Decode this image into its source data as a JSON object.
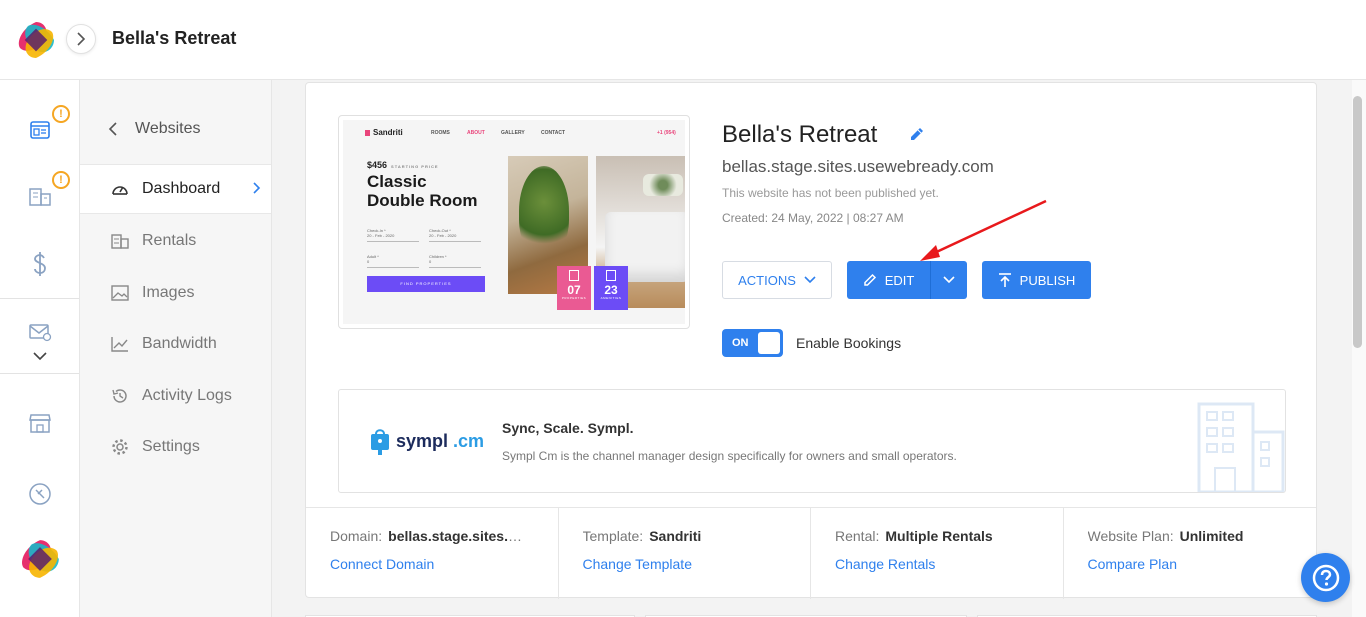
{
  "header": {
    "title": "Bella's Retreat"
  },
  "subnav": {
    "back_label": "Websites",
    "items": [
      {
        "label": "Dashboard",
        "icon": "gauge-icon",
        "active": true
      },
      {
        "label": "Rentals",
        "icon": "building-icon",
        "active": false
      },
      {
        "label": "Images",
        "icon": "image-icon",
        "active": false
      },
      {
        "label": "Bandwidth",
        "icon": "trend-icon",
        "active": false
      },
      {
        "label": "Activity Logs",
        "icon": "history-icon",
        "active": false
      },
      {
        "label": "Settings",
        "icon": "gear-icon",
        "active": false
      }
    ]
  },
  "rail": {
    "badge": "!",
    "icons": [
      "websites-icon",
      "buildings-icon",
      "dollar-icon",
      "mail-settings-icon",
      "chevron-down-icon",
      "store-icon",
      "compass-icon",
      "logo-icon"
    ]
  },
  "site": {
    "title": "Bella's Retreat",
    "url": "bellas.stage.sites.usewebready.com",
    "status": "This website has not been published yet.",
    "created": "Created: 24 May, 2022 | 08:27 AM"
  },
  "preview": {
    "brand": "Sandriti",
    "nav": [
      "ROOMS",
      "ABOUT",
      "GALLERY",
      "CONTACT"
    ],
    "phone": "+1 (954)",
    "price": "$456",
    "price_note": "STARTING PRICE",
    "room_title": "Classic Double Room",
    "fields": [
      "Check-In *",
      "Check-Out *",
      "Adult *",
      "Children *"
    ],
    "field_values": [
      "20 - Feb - 2020",
      "20 - Feb - 2020",
      "0",
      "0"
    ],
    "button": "FIND PROPERTIES",
    "stat1_num": "07",
    "stat1_label": "PROPERTIES",
    "stat2_num": "23",
    "stat2_label": "AMENITIES"
  },
  "actions": {
    "actions_label": "ACTIONS",
    "edit_label": "EDIT",
    "publish_label": "PUBLISH"
  },
  "bookings": {
    "toggle_state": "ON",
    "label": "Enable Bookings"
  },
  "promo": {
    "logo_text": "sympl",
    "logo_suffix": ".cm",
    "heading": "Sync, Scale. Sympl.",
    "description": "Sympl Cm is the channel manager design specifically for owners and small operators."
  },
  "info": [
    {
      "label": "Domain:",
      "value": "bellas.stage.sites.usewebready.com",
      "link": "Connect Domain"
    },
    {
      "label": "Template:",
      "value": "Sandriti",
      "link": "Change Template"
    },
    {
      "label": "Rental:",
      "value": "Multiple Rentals",
      "link": "Change Rentals"
    },
    {
      "label": "Website Plan:",
      "value": "Unlimited",
      "link": "Compare Plan"
    }
  ],
  "colors": {
    "accent": "#2f80ed",
    "warning": "#f5a623",
    "pink": "#ea5a93",
    "purple": "#6c4cf6"
  }
}
